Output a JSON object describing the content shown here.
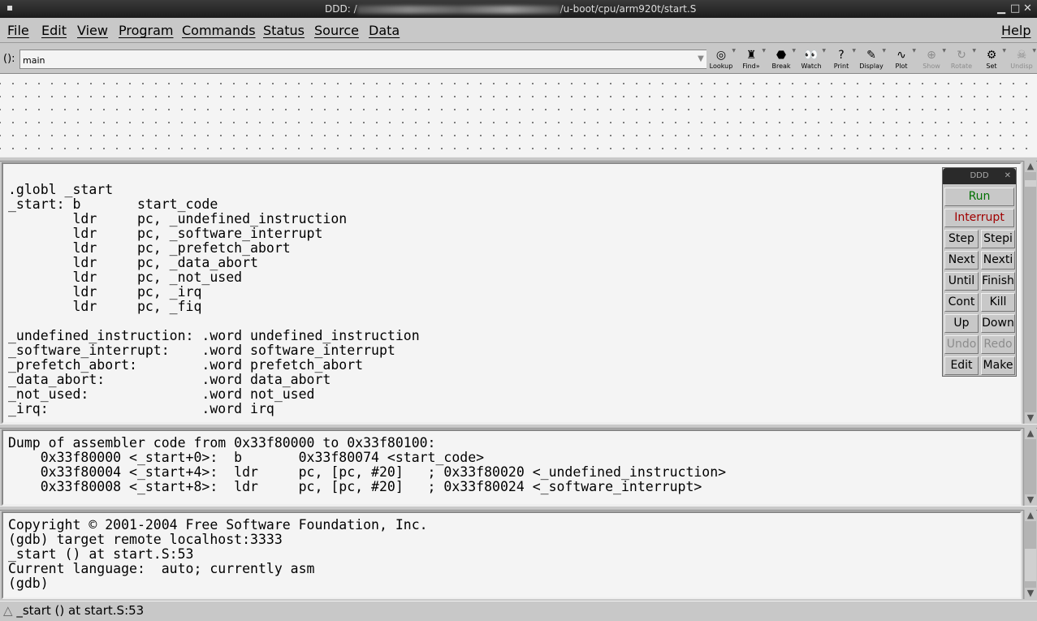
{
  "window": {
    "title_prefix": "DDD: /",
    "title_suffix": "/u-boot/cpu/arm920t/start.S"
  },
  "menu": [
    "File",
    "Edit",
    "View",
    "Program",
    "Commands",
    "Status",
    "Source",
    "Data",
    "Help"
  ],
  "argbar": {
    "label": "():",
    "value": "main"
  },
  "toolbar": [
    {
      "label": "Lookup",
      "icon": "lookup-icon",
      "glyph": "◎",
      "enabled": true
    },
    {
      "label": "Find»",
      "icon": "binoculars-icon",
      "glyph": "♜",
      "enabled": true
    },
    {
      "label": "Break",
      "icon": "stop-sign-icon",
      "glyph": "⬣",
      "enabled": true
    },
    {
      "label": "Watch",
      "icon": "eyes-icon",
      "glyph": "👀",
      "enabled": true
    },
    {
      "label": "Print",
      "icon": "question-icon",
      "glyph": "?",
      "enabled": true
    },
    {
      "label": "Display",
      "icon": "display-icon",
      "glyph": "✎",
      "enabled": true
    },
    {
      "label": "Plot",
      "icon": "plot-icon",
      "glyph": "∿",
      "enabled": true
    },
    {
      "label": "Show",
      "icon": "magnifier-icon",
      "glyph": "⊕",
      "enabled": false
    },
    {
      "label": "Rotate",
      "icon": "rotate-icon",
      "glyph": "↻",
      "enabled": false
    },
    {
      "label": "Set",
      "icon": "gear-icon",
      "glyph": "⚙",
      "enabled": true
    },
    {
      "label": "Undisp",
      "icon": "skull-icon",
      "glyph": "☠",
      "enabled": false
    }
  ],
  "source": [
    ".globl _start",
    "_start: b       start_code",
    "        ldr     pc, _undefined_instruction",
    "        ldr     pc, _software_interrupt",
    "        ldr     pc, _prefetch_abort",
    "        ldr     pc, _data_abort",
    "        ldr     pc, _not_used",
    "        ldr     pc, _irq",
    "        ldr     pc, _fiq",
    "",
    "_undefined_instruction: .word undefined_instruction",
    "_software_interrupt:    .word software_interrupt",
    "_prefetch_abort:        .word prefetch_abort",
    "_data_abort:            .word data_abort",
    "_not_used:              .word not_used",
    "_irq:                   .word irq"
  ],
  "assembler": [
    "Dump of assembler code from 0x33f80000 to 0x33f80100:",
    "    0x33f80000 <_start+0>:  b       0x33f80074 <start_code>",
    "    0x33f80004 <_start+4>:  ldr     pc, [pc, #20]   ; 0x33f80020 <_undefined_instruction>",
    "    0x33f80008 <_start+8>:  ldr     pc, [pc, #20]   ; 0x33f80024 <_software_interrupt>"
  ],
  "console": [
    "Copyright © 2001-2004 Free Software Foundation, Inc.",
    "(gdb) target remote localhost:3333",
    "_start () at start.S:53",
    "Current language:  auto; currently asm",
    "(gdb)"
  ],
  "command_tool": {
    "title": "DDD",
    "buttons": [
      {
        "label": "Run",
        "color": "#007000",
        "enabled": true
      },
      {
        "label": "Interrupt",
        "color": "#a00000",
        "enabled": true
      },
      {
        "label": "Step",
        "enabled": true
      },
      {
        "label": "Stepi",
        "enabled": true
      },
      {
        "label": "Next",
        "enabled": true
      },
      {
        "label": "Nexti",
        "enabled": true
      },
      {
        "label": "Until",
        "enabled": true
      },
      {
        "label": "Finish",
        "enabled": true
      },
      {
        "label": "Cont",
        "enabled": true
      },
      {
        "label": "Kill",
        "enabled": true
      },
      {
        "label": "Up",
        "enabled": true
      },
      {
        "label": "Down",
        "enabled": true
      },
      {
        "label": "Undo",
        "enabled": false
      },
      {
        "label": "Redo",
        "enabled": false
      },
      {
        "label": "Edit",
        "enabled": true
      },
      {
        "label": "Make",
        "enabled": true
      }
    ]
  },
  "status": "_start () at start.S:53"
}
